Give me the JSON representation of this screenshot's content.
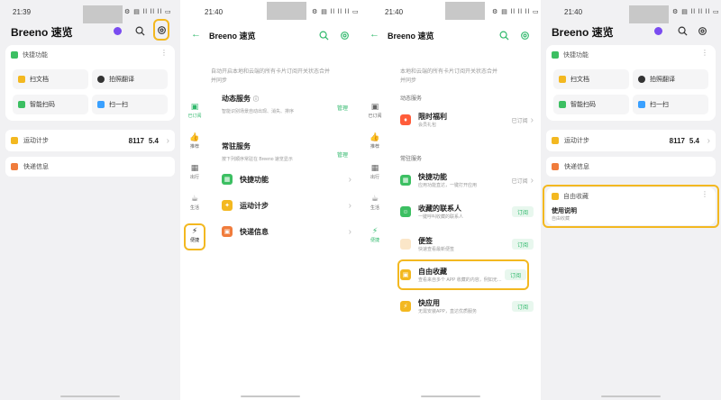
{
  "colors": {
    "accent": "#2fb86b",
    "highlight": "#f3b820",
    "green_icon": "#3cbf62",
    "yellow_icon": "#f3b820",
    "orange_icon": "#f07c3c",
    "blue_icon": "#3aa0ff",
    "purple_icon": "#7a4cf0"
  },
  "status": {
    "p1_time": "21:39",
    "p2_time": "21:40",
    "p3_time": "21:40",
    "p4_time": "21:40",
    "icons": "⚙ ▤ ll ll ll ▭"
  },
  "panel1": {
    "title": "Breeno 速览",
    "quick_header": "快捷功能",
    "tiles": [
      "扫文档",
      "拍照翻译",
      "智能扫码",
      "扫一扫"
    ],
    "steps_label": "运动计步",
    "steps_value": "8117",
    "steps_distance": "5.4",
    "express_label": "快递信息"
  },
  "panel2": {
    "title": "Breeno 速览",
    "desc_line1": "自动开启本地和云端的所有卡片订阅开关状态合并",
    "desc_line2": "并同步",
    "dynamic_title": "动态服务",
    "dynamic_sub": "智能识别场景自动出现、消失、排序",
    "manage1": "管理",
    "resident_title": "常驻服务",
    "resident_sub": "按下列顺序常驻在 Breeno 速览显示",
    "manage2": "管理",
    "rows": [
      "快捷功能",
      "运动计步",
      "快递信息"
    ],
    "sidebar": [
      "已订阅",
      "推荐",
      "出行",
      "生活",
      "便捷"
    ]
  },
  "panel3": {
    "title": "Breeno 速览",
    "desc_line1": "本地和云端的所有卡片订阅开关状态合并",
    "desc_line2": "并同步",
    "dynamic_section": "动态服务",
    "limited_title": "限时福利",
    "limited_sub": "会员礼包",
    "limited_status": "已订阅",
    "resident_section": "常驻服务",
    "items": [
      {
        "name": "快捷功能",
        "sub": "应用功能直达，一键打开应用",
        "status": "已订阅"
      },
      {
        "name": "收藏的联系人",
        "sub": "一键呼叫收藏的联系人",
        "status": "订阅"
      },
      {
        "name": "便签",
        "sub": "快速查看最新便签",
        "status": "订阅"
      },
      {
        "name": "自由收藏",
        "sub": "查看来自多个 APP 收藏的内容，例如无…",
        "status": "订阅"
      },
      {
        "name": "快应用",
        "sub": "无需安装APP，直达优质服务",
        "status": "订阅"
      }
    ],
    "sidebar": [
      "已订阅",
      "推荐",
      "出行",
      "生活",
      "便捷"
    ]
  },
  "panel4": {
    "title": "Breeno 速览",
    "quick_header": "快捷功能",
    "tiles": [
      "扫文档",
      "拍照翻译",
      "智能扫码",
      "扫一扫"
    ],
    "steps_label": "运动计步",
    "steps_value": "8117",
    "steps_distance": "5.4",
    "express_label": "快递信息",
    "collect_header": "自由收藏",
    "collect_title": "使用说明",
    "collect_sub": "自由收藏"
  }
}
